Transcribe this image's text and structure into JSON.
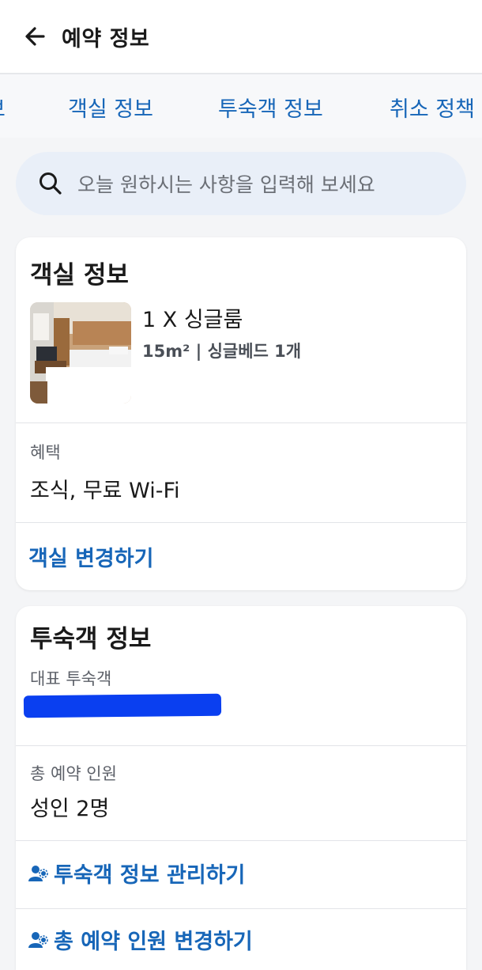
{
  "header": {
    "title": "예약 정보",
    "back_icon": "arrow-left-icon"
  },
  "tabs": [
    {
      "label": "보"
    },
    {
      "label": "객실 정보"
    },
    {
      "label": "투숙객 정보"
    },
    {
      "label": "취소 정책"
    }
  ],
  "search": {
    "placeholder": "오늘 원하시는 사항을 입력해 보세요",
    "icon": "search-icon"
  },
  "room_card": {
    "title": "객실 정보",
    "room_name": "1 X 싱글룸",
    "room_meta": "15m² | 싱글베드 1개",
    "benefit_label": "혜택",
    "benefit_value": "조식, 무료 Wi-Fi",
    "change_room_link": "객실 변경하기"
  },
  "guest_card": {
    "title": "투숙객 정보",
    "main_guest_label": "대표 투숙객",
    "total_label": "총 예약 인원",
    "total_value": "성인 2명",
    "manage_guests_link": "투숙객 정보 관리하기",
    "change_count_link": "총 예약 인원 변경하기"
  },
  "colors": {
    "accent": "#1766b8",
    "redaction": "#0a3ff0",
    "search_bg": "#e9eff8"
  }
}
